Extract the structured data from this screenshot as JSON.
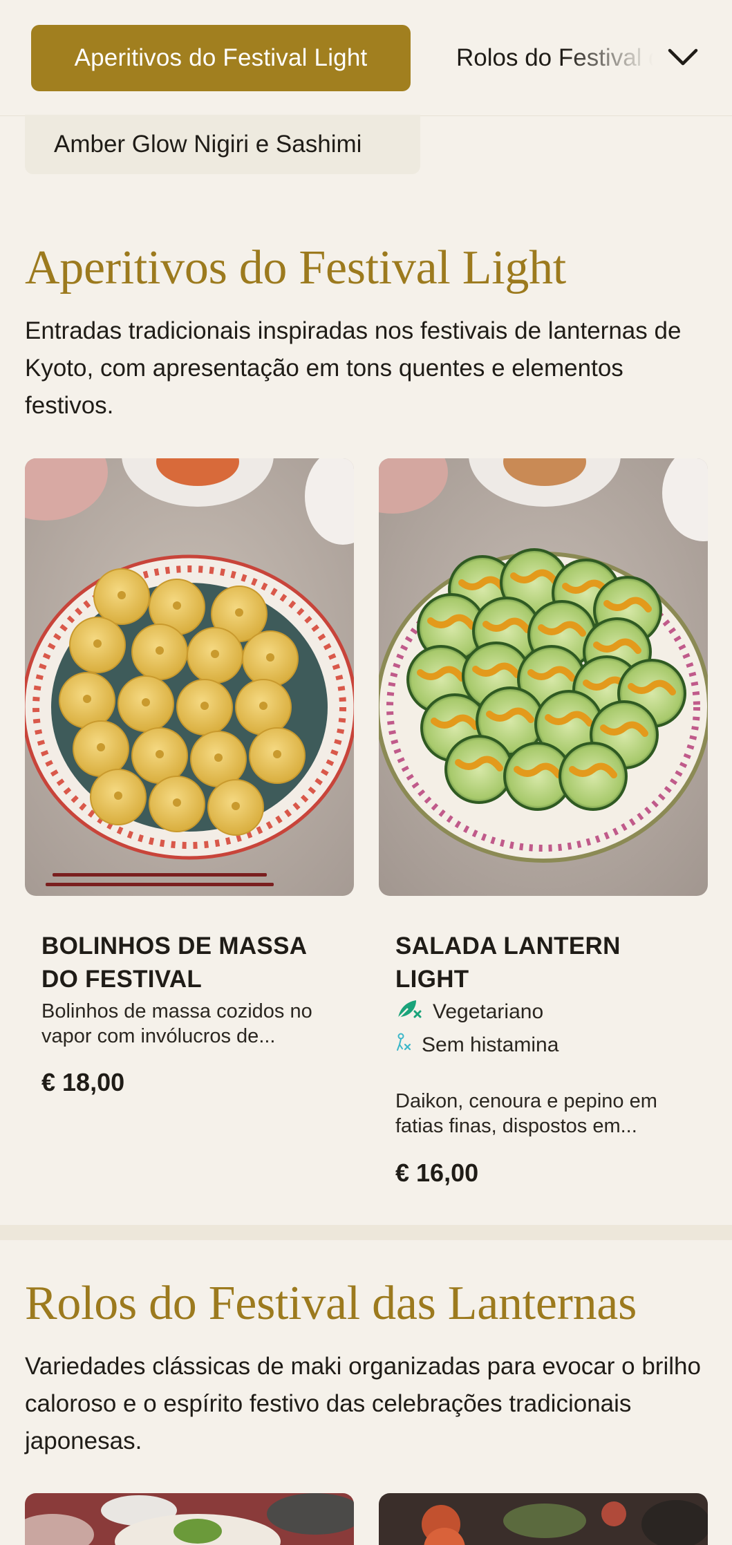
{
  "nav": {
    "active_tab": "Aperitivos do Festival Light",
    "next_tab": "Rolos do Festival das Lanternas",
    "second_row_tab": "Amber Glow Nigiri e Sashimi",
    "dropdown_icon": "chevron-down-icon"
  },
  "sections": [
    {
      "title": "Aperitivos do Festival Light",
      "description": "Entradas tradicionais inspiradas nos festivais de lanternas de Kyoto, com apresentação em tons quentes e elementos festivos.",
      "items": [
        {
          "name": "Bolinhos de massa do festival",
          "description": "Bolinhos de massa cozidos no vapor com invólucros de...",
          "price": "€ 18,00",
          "tags": []
        },
        {
          "name": "Salada Lantern Light",
          "description": "Daikon, cenoura e pepino em fatias finas, dispostos em...",
          "price": "€ 16,00",
          "tags": [
            {
              "label": "Vegetariano",
              "icon": "leaf-icon",
              "color": "#1aa37a"
            },
            {
              "label": "Sem histamina",
              "icon": "histamine-free-icon",
              "color": "#3bb7c9"
            }
          ]
        }
      ]
    },
    {
      "title": "Rolos do Festival das Lanternas",
      "description": "Variedades clássicas de maki organizadas para evocar o brilho caloroso e o espírito festivo das celebrações tradicionais japonesas."
    }
  ],
  "colors": {
    "accent": "#a17f1f",
    "heading": "#9c7a1e",
    "background": "#f5f1ea"
  }
}
